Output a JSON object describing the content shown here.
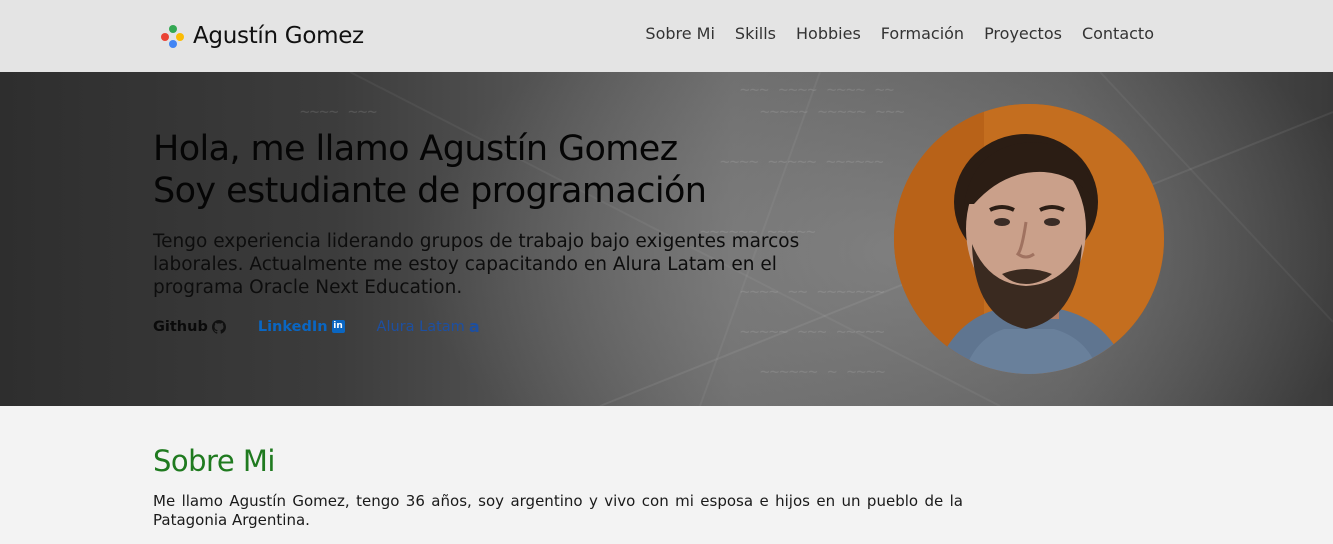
{
  "header": {
    "brand_name": "Agustín Gomez",
    "nav": [
      {
        "label": "Sobre Mi"
      },
      {
        "label": "Skills"
      },
      {
        "label": "Hobbies"
      },
      {
        "label": "Formación"
      },
      {
        "label": "Proyectos"
      },
      {
        "label": "Contacto"
      }
    ]
  },
  "hero": {
    "title_line1": "Hola, me llamo Agustín Gomez",
    "title_line2": "Soy estudiante de programación",
    "text": "Tengo experiencia liderando grupos de trabajo bajo exigentes marcos laborales. Actualmente me estoy capacitando en Alura Latam en el programa Oracle Next Education.",
    "links": {
      "github": "Github",
      "linkedin": "LinkedIn",
      "alura": "Alura Latam"
    }
  },
  "about": {
    "title": "Sobre Mi",
    "text": "Me llamo Agustín Gomez, tengo 36 años, soy argentino y vivo con mi esposa e hijos en un pueblo de la Patagonia Argentina."
  },
  "colors": {
    "header_bg": "#e4e4e4",
    "about_title": "#1f7a1f",
    "linkedin": "#0a66c2",
    "alura": "#1d4fa0",
    "brand_dot_green": "#34a853",
    "brand_dot_red": "#ea4335",
    "brand_dot_yellow": "#fbbc05",
    "brand_dot_blue": "#4285f4"
  },
  "icons": {
    "brand": "google-dots-icon",
    "github": "github-octocat-icon",
    "linkedin": "linkedin-icon",
    "alura": "alura-logo-icon"
  }
}
